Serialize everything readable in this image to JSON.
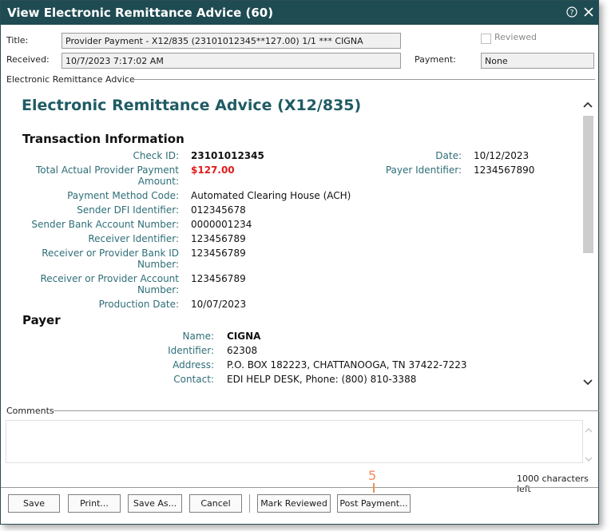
{
  "window": {
    "title": "View Electronic Remittance Advice (60)"
  },
  "header": {
    "title_label": "Title:",
    "title_value": "Provider Payment - X12/835 (23101012345**127.00) 1/1 ***  CIGNA",
    "received_label": "Received:",
    "received_value": "10/7/2023 7:17:02 AM",
    "reviewed_label": "Reviewed",
    "payment_label": "Payment:",
    "payment_value": "None"
  },
  "group_label": "Electronic Remittance Advice",
  "era": {
    "title": "Electronic Remittance Advice (X12/835)",
    "transaction_heading": "Transaction Information",
    "check_id_label": "Check ID:",
    "check_id": "23101012345",
    "date_label": "Date:",
    "date": "10/12/2023",
    "total_label_1": "Total Actual Provider Payment",
    "total_label_2": "Amount:",
    "total": "$127.00",
    "payer_identifier_label": "Payer Identifier:",
    "payer_identifier": "1234567890",
    "payment_method_label": "Payment Method Code:",
    "payment_method": "Automated Clearing House (ACH)",
    "sender_dfi_label": "Sender DFI Identifier:",
    "sender_dfi": "012345678",
    "sender_bank_label": "Sender Bank Account Number:",
    "sender_bank": "0000001234",
    "receiver_id_label": "Receiver Identifier:",
    "receiver_id": "123456789",
    "receiver_bank_label_1": "Receiver or Provider Bank ID",
    "receiver_bank_label_2": "Number:",
    "receiver_bank": "123456789",
    "receiver_acct_label_1": "Receiver or Provider Account",
    "receiver_acct_label_2": "Number:",
    "receiver_acct": "123456789",
    "production_date_label": "Production Date:",
    "production_date": "10/07/2023",
    "payer_heading": "Payer",
    "payer_name_label": "Name:",
    "payer_name": "CIGNA",
    "payer_ident_label": "Identifier:",
    "payer_ident": "62308",
    "payer_address_label": "Address:",
    "payer_address": "P.O. BOX 182223, CHATTANOOGA, TN 37422-7223",
    "payer_contact_label": "Contact:",
    "payer_contact": "EDI HELP DESK, Phone:  (800) 810-3388"
  },
  "comments": {
    "label": "Comments",
    "char_count": "1000 characters left"
  },
  "buttons": {
    "save": "Save",
    "print": "Print...",
    "save_as": "Save As...",
    "cancel": "Cancel",
    "mark_reviewed": "Mark Reviewed",
    "post_payment": "Post Payment..."
  },
  "callout": "5",
  "colors": {
    "titlebar": "#1f4b52",
    "accent": "#1f5b64",
    "amount": "#e01b1b",
    "callout": "#f08a5d"
  }
}
